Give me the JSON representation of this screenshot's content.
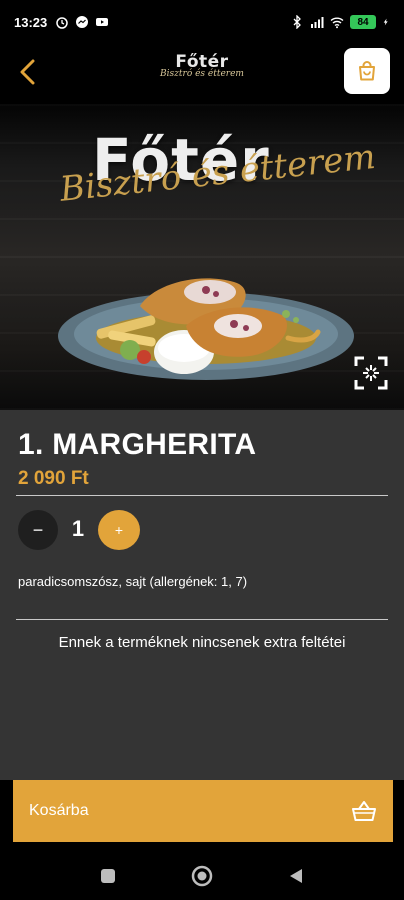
{
  "status_bar": {
    "time": "13:23",
    "battery": "84"
  },
  "header": {
    "logo_main": "Főtér",
    "logo_sub": "Bisztró és étterem"
  },
  "hero": {
    "title": "Főtér",
    "subtitle": "Bisztró és étterem"
  },
  "product": {
    "title": "1. MARGHERITA",
    "price": "2 090 Ft",
    "quantity": "1",
    "minus_label": "−",
    "plus_label": "+",
    "ingredients": "paradicsomszósz, sajt (allergének: 1, 7)",
    "no_extras_text": "Ennek a terméknek nincsenek extra feltétei"
  },
  "cart": {
    "button_label": "Kosárba"
  },
  "colors": {
    "accent": "#e2a43a",
    "panel": "#343434",
    "background": "#000000"
  }
}
